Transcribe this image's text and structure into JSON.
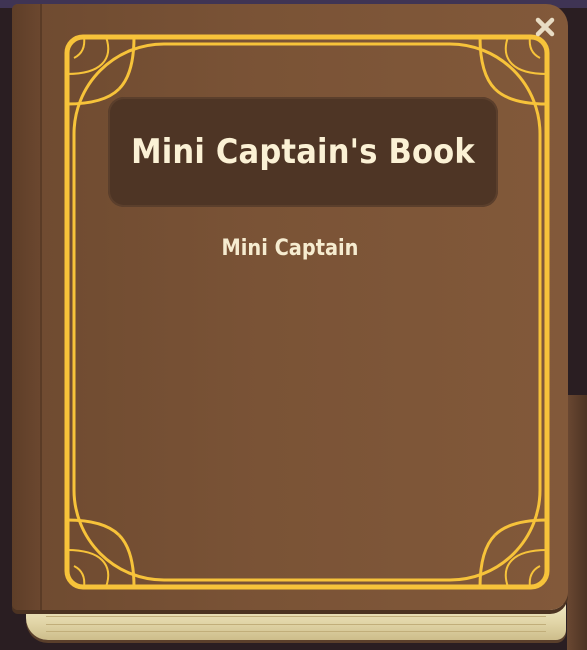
{
  "book": {
    "title": "Mini Captain's Book",
    "author": "Mini Captain"
  },
  "controls": {
    "close_icon": "close-x-icon"
  },
  "colors": {
    "cover": "#7a5336",
    "frame_gold": "#f7c33a",
    "title_panel": "#4e3525",
    "text": "#fbf1d5"
  }
}
